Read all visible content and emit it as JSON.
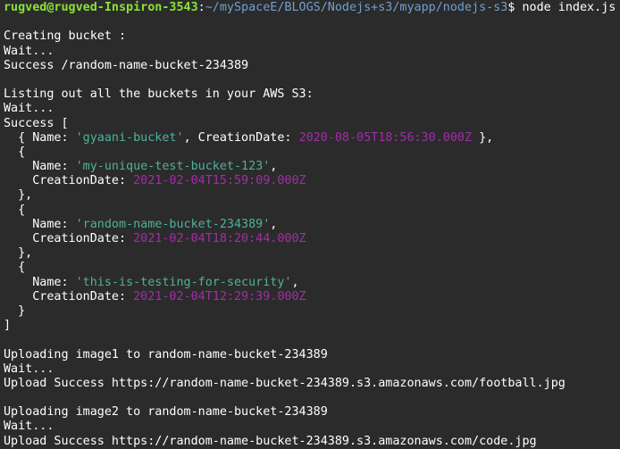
{
  "prompt": {
    "user": "rugved@rugved-Inspiron-3543",
    "sep": ":",
    "path": "~/mySpaceE/BLOGS/Nodejs+s3/myapp/nodejs-s3",
    "symbol": "$",
    "command": " node index.js"
  },
  "colors": {
    "background": "#2b2b2b",
    "text": "#ffffff",
    "user": "#8ae234",
    "path": "#729fcf",
    "string": "#4eb29b",
    "date": "#a12ea8"
  },
  "lines": [
    [],
    [
      {
        "t": "Creating bucket :"
      }
    ],
    [
      {
        "t": "Wait..."
      }
    ],
    [
      {
        "t": "Success /random-name-bucket-234389"
      }
    ],
    [],
    [
      {
        "t": "Listing out all the buckets in your AWS S3:"
      }
    ],
    [
      {
        "t": "Wait..."
      }
    ],
    [
      {
        "t": "Success ["
      }
    ],
    [
      {
        "t": "  { Name: "
      },
      {
        "t": "'gyaani-bucket'",
        "c": "str"
      },
      {
        "t": ", CreationDate: "
      },
      {
        "t": "2020-08-05T18:56:30.000Z",
        "c": "date"
      },
      {
        "t": " },"
      }
    ],
    [
      {
        "t": "  {"
      }
    ],
    [
      {
        "t": "    Name: "
      },
      {
        "t": "'my-unique-test-bucket-123'",
        "c": "str"
      },
      {
        "t": ","
      }
    ],
    [
      {
        "t": "    CreationDate: "
      },
      {
        "t": "2021-02-04T15:59:09.000Z",
        "c": "date"
      }
    ],
    [
      {
        "t": "  },"
      }
    ],
    [
      {
        "t": "  {"
      }
    ],
    [
      {
        "t": "    Name: "
      },
      {
        "t": "'random-name-bucket-234389'",
        "c": "str"
      },
      {
        "t": ","
      }
    ],
    [
      {
        "t": "    CreationDate: "
      },
      {
        "t": "2021-02-04T18:20:44.000Z",
        "c": "date"
      }
    ],
    [
      {
        "t": "  },"
      }
    ],
    [
      {
        "t": "  {"
      }
    ],
    [
      {
        "t": "    Name: "
      },
      {
        "t": "'this-is-testing-for-security'",
        "c": "str"
      },
      {
        "t": ","
      }
    ],
    [
      {
        "t": "    CreationDate: "
      },
      {
        "t": "2021-02-04T12:29:39.000Z",
        "c": "date"
      }
    ],
    [
      {
        "t": "  }"
      }
    ],
    [
      {
        "t": "]"
      }
    ],
    [],
    [
      {
        "t": "Uploading image1 to random-name-bucket-234389"
      }
    ],
    [
      {
        "t": "Wait..."
      }
    ],
    [
      {
        "t": "Upload Success https://random-name-bucket-234389.s3.amazonaws.com/football.jpg"
      }
    ],
    [],
    [
      {
        "t": "Uploading image2 to random-name-bucket-234389"
      }
    ],
    [
      {
        "t": "Wait..."
      }
    ],
    [
      {
        "t": "Upload Success https://random-name-bucket-234389.s3.amazonaws.com/code.jpg"
      }
    ]
  ]
}
